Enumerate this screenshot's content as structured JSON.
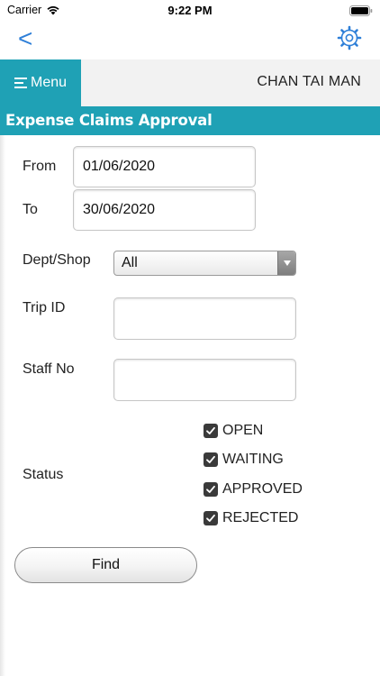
{
  "status_bar": {
    "carrier": "Carrier",
    "time": "9:22 PM"
  },
  "nav": {
    "back_label": "<",
    "settings_icon": "gear-icon",
    "accent_color": "#2e7fd8"
  },
  "header": {
    "menu_label": "Menu",
    "user_name": "CHAN TAI MAN",
    "accent_color": "#1fa1b5"
  },
  "page": {
    "title": "Expense Claims Approval"
  },
  "form": {
    "from": {
      "label": "From",
      "value": "01/06/2020"
    },
    "to": {
      "label": "To",
      "value": "30/06/2020"
    },
    "dept_shop": {
      "label": "Dept/Shop",
      "selected": "All"
    },
    "trip_id": {
      "label": "Trip ID",
      "value": ""
    },
    "staff_no": {
      "label": "Staff No",
      "value": ""
    },
    "status": {
      "label": "Status",
      "options": [
        {
          "label": "OPEN",
          "checked": true
        },
        {
          "label": "WAITING",
          "checked": true
        },
        {
          "label": "APPROVED",
          "checked": true
        },
        {
          "label": "REJECTED",
          "checked": true
        }
      ]
    },
    "find_label": "Find"
  }
}
